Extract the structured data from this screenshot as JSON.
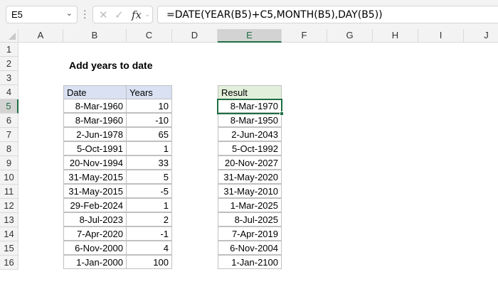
{
  "name_box": "E5",
  "formula": "=DATE(YEAR(B5)+C5,MONTH(B5),DAY(B5))",
  "columns": [
    "A",
    "B",
    "C",
    "D",
    "E",
    "F",
    "G",
    "H",
    "I",
    "J"
  ],
  "rows": [
    "1",
    "2",
    "3",
    "4",
    "5",
    "6",
    "7",
    "8",
    "9",
    "10",
    "11",
    "12",
    "13",
    "14",
    "15",
    "16"
  ],
  "selected_cell": "E5",
  "title": "Add years to date",
  "headers": {
    "date": "Date",
    "years": "Years",
    "result": "Result"
  },
  "colors": {
    "input_header": "#D9E1F2",
    "result_header": "#E2EFDA",
    "selection": "#1E6E42"
  },
  "data": [
    {
      "date": "8-Mar-1960",
      "years": "10",
      "result": "8-Mar-1970"
    },
    {
      "date": "8-Mar-1960",
      "years": "-10",
      "result": "8-Mar-1950"
    },
    {
      "date": "2-Jun-1978",
      "years": "65",
      "result": "2-Jun-2043"
    },
    {
      "date": "5-Oct-1991",
      "years": "1",
      "result": "5-Oct-1992"
    },
    {
      "date": "20-Nov-1994",
      "years": "33",
      "result": "20-Nov-2027"
    },
    {
      "date": "31-May-2015",
      "years": "5",
      "result": "31-May-2020"
    },
    {
      "date": "31-May-2015",
      "years": "-5",
      "result": "31-May-2010"
    },
    {
      "date": "29-Feb-2024",
      "years": "1",
      "result": "1-Mar-2025"
    },
    {
      "date": "8-Jul-2023",
      "years": "2",
      "result": "8-Jul-2025"
    },
    {
      "date": "7-Apr-2020",
      "years": "-1",
      "result": "7-Apr-2019"
    },
    {
      "date": "6-Nov-2000",
      "years": "4",
      "result": "6-Nov-2004"
    },
    {
      "date": "1-Jan-2000",
      "years": "100",
      "result": "1-Jan-2100"
    }
  ]
}
